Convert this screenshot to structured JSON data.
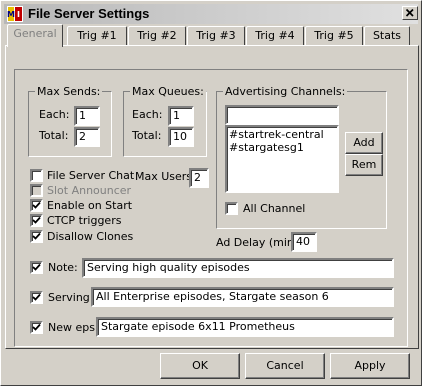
{
  "window": {
    "title": "File Server Settings"
  },
  "tabs": [
    "General",
    "Trig #1",
    "Trig #2",
    "Trig #3",
    "Trig #4",
    "Trig #5",
    "Stats"
  ],
  "max_sends": {
    "title": "Max Sends:",
    "each_label": "Each:",
    "each_value": "1",
    "total_label": "Total:",
    "total_value": "2"
  },
  "max_queues": {
    "title": "Max Queues:",
    "each_label": "Each:",
    "each_value": "1",
    "total_label": "Total:",
    "total_value": "10"
  },
  "advertising": {
    "title": "Advertising Channels:",
    "input_value": "",
    "channels": [
      "#startrek-central",
      "#stargatesg1"
    ],
    "add_label": "Add",
    "rem_label": "Rem",
    "all_channel_label": "All Channel",
    "all_channel_checked": false
  },
  "options": {
    "file_server_chat": {
      "label": "File Server Chat",
      "checked": false
    },
    "slot_announcer": {
      "label": "Slot Announcer",
      "checked": false,
      "disabled": true
    },
    "enable_on_start": {
      "label": "Enable on Start",
      "checked": true
    },
    "ctcp_triggers": {
      "label": "CTCP triggers",
      "checked": true
    },
    "disallow_clones": {
      "label": "Disallow Clones",
      "checked": true
    }
  },
  "max_users": {
    "label": "Max Users:",
    "value": "2"
  },
  "ad_delay": {
    "label": "Ad Delay (min):",
    "value": "40"
  },
  "note": {
    "label": "Note:",
    "checked": true,
    "value": "Serving high quality episodes"
  },
  "serving": {
    "label": "Serving:",
    "checked": true,
    "value": "All Enterprise episodes, Stargate season 6"
  },
  "new_eps": {
    "label": "New eps:",
    "checked": true,
    "value": "Stargate episode 6x11 Prometheus"
  },
  "buttons": {
    "ok": "OK",
    "cancel": "Cancel",
    "apply": "Apply"
  }
}
